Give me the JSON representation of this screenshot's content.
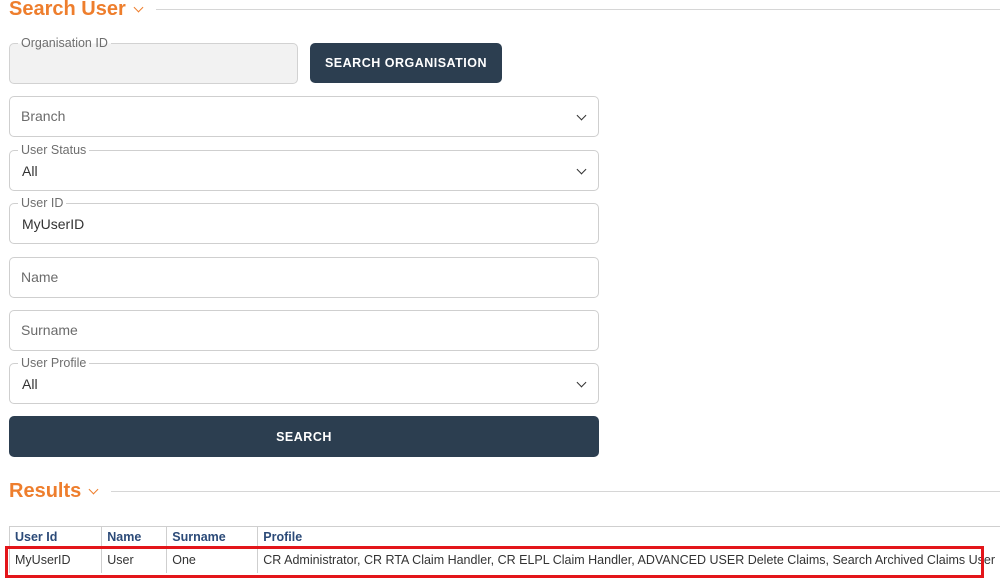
{
  "search_section": {
    "title": "Search User"
  },
  "form": {
    "organisation_id": {
      "label": "Organisation ID",
      "value": ""
    },
    "search_org_button": "SEARCH ORGANISATION",
    "branch": {
      "placeholder": "Branch"
    },
    "user_status": {
      "label": "User Status",
      "value": "All"
    },
    "user_id": {
      "label": "User ID",
      "value": "MyUserID"
    },
    "name": {
      "placeholder": "Name"
    },
    "surname": {
      "placeholder": "Surname"
    },
    "user_profile": {
      "label": "User Profile",
      "value": "All"
    },
    "search_button": "SEARCH"
  },
  "results_section": {
    "title": "Results"
  },
  "results_table": {
    "headers": [
      "User Id",
      "Name",
      "Surname",
      "Profile"
    ],
    "rows": [
      [
        "MyUserID",
        "User",
        "One",
        "CR Administrator, CR RTA Claim Handler, CR ELPL Claim Handler, ADVANCED USER Delete Claims, Search Archived Claims User"
      ]
    ]
  },
  "colors": {
    "accent": "#ee7e2d",
    "button": "#2c3e50",
    "header_text": "#2b4a78",
    "highlight": "#e3151a"
  }
}
